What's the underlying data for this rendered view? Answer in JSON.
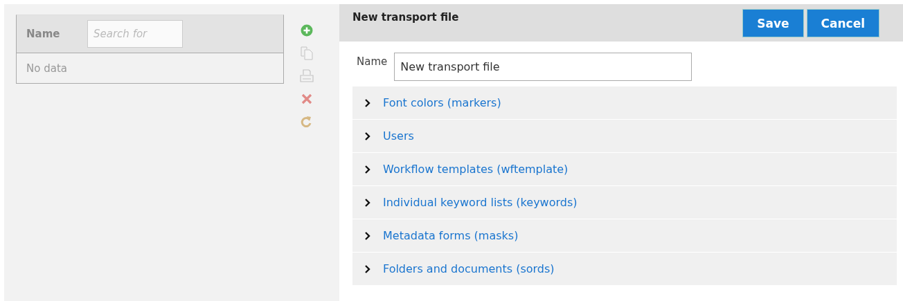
{
  "list_panel": {
    "columns": [
      {
        "label": "Name",
        "search": {
          "placeholder": "Search for"
        }
      }
    ],
    "empty_text": "No data"
  },
  "toolbar": [
    {
      "kind": "add",
      "disabled": false
    },
    {
      "kind": "copy",
      "disabled": true
    },
    {
      "kind": "print",
      "disabled": true
    },
    {
      "kind": "delete",
      "disabled": true
    },
    {
      "kind": "refresh",
      "disabled": true
    }
  ],
  "editor": {
    "title": "New transport file",
    "buttons": [
      "Save",
      "Cancel"
    ],
    "name_field": {
      "label": "Name",
      "value": "New transport file"
    },
    "sections": [
      {
        "label": "Font colors (markers)",
        "expanded": false
      },
      {
        "label": "Users",
        "expanded": false
      },
      {
        "label": "Workflow templates (wftemplate)",
        "expanded": false
      },
      {
        "label": "Individual keyword lists (keywords)",
        "expanded": false
      },
      {
        "label": "Metadata forms (masks)",
        "expanded": false
      },
      {
        "label": "Folders and documents (sords)",
        "expanded": false
      }
    ]
  }
}
